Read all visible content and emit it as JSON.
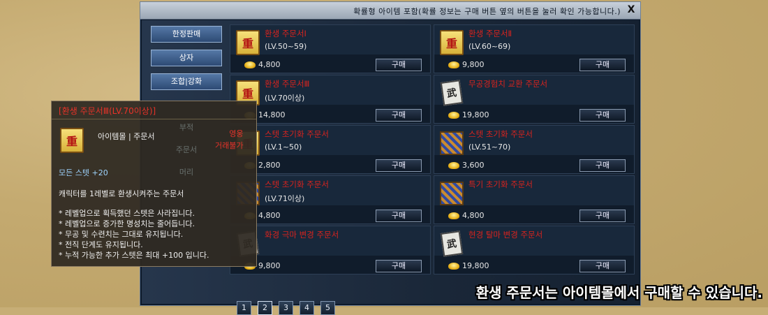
{
  "window": {
    "title": "확률형 아이템 포함(확률 정보는 구매 버튼 옆의 버튼을 눌러 확인 가능합니다.)",
    "close": "X"
  },
  "sidebar": {
    "items": [
      {
        "label": "한정판매"
      },
      {
        "label": "상자"
      },
      {
        "label": "조합|강화"
      }
    ]
  },
  "ghost_sidebar": [
    "부적",
    "주문서",
    "머리"
  ],
  "items": [
    {
      "name": "환생 주문서Ⅰ",
      "level": "(LV.50~59)",
      "price": "4,800",
      "buy": "구매",
      "icon": "scroll-icon"
    },
    {
      "name": "환생 주문서Ⅱ",
      "level": "(LV.60~69)",
      "price": "9,800",
      "buy": "구매",
      "icon": "scroll-icon"
    },
    {
      "name": "환생 주문서Ⅲ",
      "level": "(LV.70이상)",
      "price": "14,800",
      "buy": "구매",
      "icon": "scroll-icon"
    },
    {
      "name": "무공경험치 교환 주문서",
      "level": "",
      "price": "19,800",
      "buy": "구매",
      "icon": "book-icon"
    },
    {
      "name": "스텟 초기화 주문서",
      "level": "(LV.1~50)",
      "price": "2,800",
      "buy": "구매",
      "icon": "scroll-icon"
    },
    {
      "name": "스텟 초기화 주문서",
      "level": "(LV.51~70)",
      "price": "3,600",
      "buy": "구매",
      "icon": "rug-icon"
    },
    {
      "name": "스텟 초기화 주문서",
      "level": "(LV.71이상)",
      "price": "4,800",
      "buy": "구매",
      "icon": "rug-icon"
    },
    {
      "name": "특기 초기화 주문서",
      "level": "",
      "price": "4,800",
      "buy": "구매",
      "icon": "rug-icon"
    },
    {
      "name": "화경 극마 변경 주문서",
      "level": "",
      "price": "9,800",
      "buy": "구매",
      "icon": "book-icon"
    },
    {
      "name": "현경 탈마 변경 주문서",
      "level": "",
      "price": "19,800",
      "buy": "구매",
      "icon": "book-icon"
    }
  ],
  "pager": {
    "pages": [
      "1",
      "2",
      "3",
      "4",
      "5"
    ],
    "active": "2"
  },
  "tooltip": {
    "title": "[환생 주문서Ⅲ(LV.70이상)]",
    "category": "아이템몰 | 주문서",
    "stat": "모든 스텟 +20",
    "desc": "캐릭터를 1레벨로 환생시켜주는 주문서",
    "notes": [
      "* 레벨업으로 획득했던 스텟은 사라집니다.",
      "* 레벨업으로 증가한 명성치는 줄어듭니다.",
      "* 무공 및 수련치는 그대로 유지됩니다.",
      "* 전직 단계도 유지됩니다.",
      "* 누적 가능한 추가 스텟은 최대 +100 입니다."
    ],
    "flags": [
      "영웅",
      "거래불가"
    ]
  },
  "caption": "환생 주문서는 아이템몰에서 구매할 수 있습니다."
}
